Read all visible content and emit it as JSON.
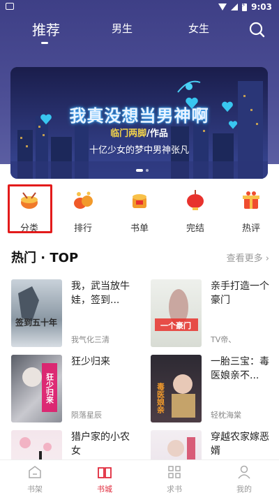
{
  "status_bar": {
    "time": "9:03"
  },
  "top_tabs": [
    {
      "label": "推荐",
      "active": true
    },
    {
      "label": "男生",
      "active": false
    },
    {
      "label": "女生",
      "active": false
    }
  ],
  "banner": {
    "title": "我真没想当男神啊",
    "author_name": "临门两脚",
    "author_suffix": "/作品",
    "tagline": "十亿少女的梦中男神张凡"
  },
  "quick_nav": [
    {
      "label": "分类",
      "icon": "drum-icon",
      "color": "#f07a2a"
    },
    {
      "label": "排行",
      "icon": "gift-icon",
      "color": "#f05a28"
    },
    {
      "label": "书单",
      "icon": "drum-list-icon",
      "color": "#f29a2b"
    },
    {
      "label": "完结",
      "icon": "lantern-icon",
      "color": "#e8322d"
    },
    {
      "label": "热评",
      "icon": "gift-box-icon",
      "color": "#ef4d2f"
    }
  ],
  "hot_section": {
    "title": "热门 · TOP",
    "see_more": "查看更多"
  },
  "books": [
    {
      "title": "我，武当放牛娃，签到...",
      "author": "我气化三清",
      "cover_text": "签到五十年"
    },
    {
      "title": "亲手打造一个豪门",
      "author": "TV帝、",
      "cover_text": "一个豪门"
    },
    {
      "title": "狂少归来",
      "author": "陨落星辰",
      "cover_text": "狂少归来"
    },
    {
      "title": "一胎三宝：毒医娘亲不...",
      "author": "轻枕海棠",
      "cover_text": "毒医娘亲"
    },
    {
      "title": "猎户家的小农女",
      "author": "",
      "cover_text": ""
    },
    {
      "title": "穿越农家嫁恶婿",
      "author": "",
      "cover_text": ""
    }
  ],
  "bottom_nav": [
    {
      "label": "书架",
      "icon": "bookshelf-icon",
      "active": false
    },
    {
      "label": "书城",
      "icon": "open-book-icon",
      "active": true
    },
    {
      "label": "求书",
      "icon": "grid-icon",
      "active": false
    },
    {
      "label": "我的",
      "icon": "person-icon",
      "active": false
    }
  ],
  "colors": {
    "header_bg": "#3e3f86",
    "accent": "#e0283a",
    "highlight_box": "#e31b1b"
  }
}
